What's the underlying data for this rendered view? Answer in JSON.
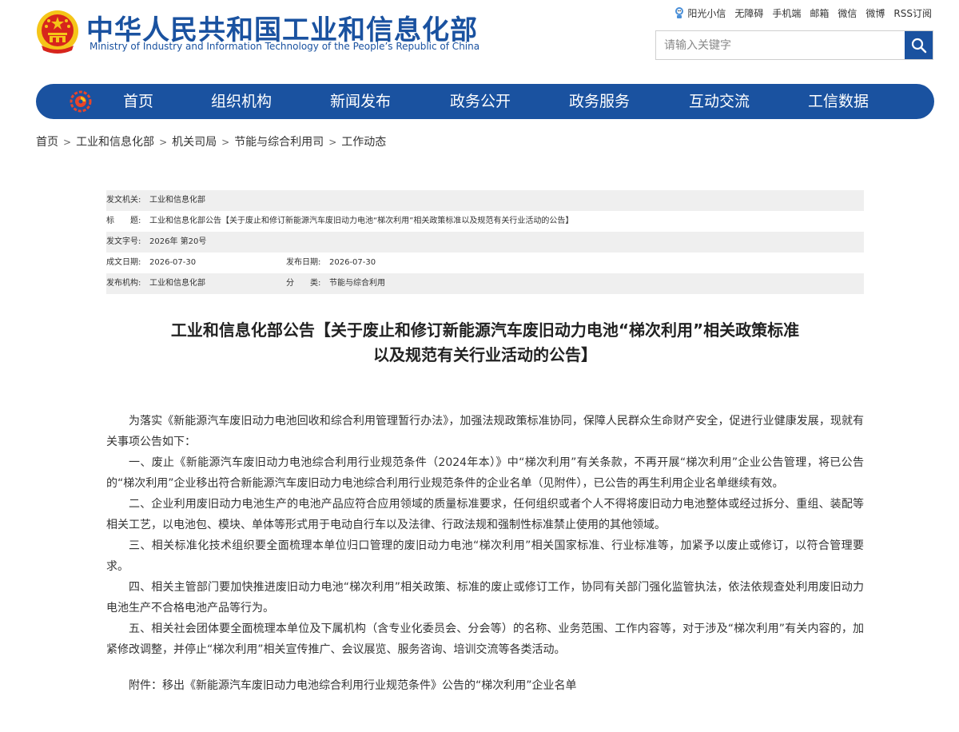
{
  "header": {
    "title_cn": "中华人民共和国工业和信息化部",
    "title_en": "Ministry of Industry and Information Technology of the People’s Republic of China",
    "top_links": [
      "阳光小信",
      "无障碍",
      "手机端",
      "邮箱",
      "微信",
      "微博",
      "RSS订阅"
    ]
  },
  "search": {
    "placeholder": "请输入关键字"
  },
  "nav": {
    "items": [
      "首页",
      "组织机构",
      "新闻发布",
      "政务公开",
      "政务服务",
      "互动交流",
      "工信数据"
    ]
  },
  "breadcrumb": [
    "首页",
    "工业和信息化部",
    "机关司局",
    "节能与综合利用司",
    "工作动态"
  ],
  "info": {
    "issuer_label": "发文机关:",
    "issuer": "工业和信息化部",
    "title_label": "标　　题:",
    "title": "工业和信息化部公告【关于废止和修订新能源汽车废旧动力电池“梯次利用”相关政策标准以及规范有关行业活动的公告】",
    "doc_no_label": "发文字号:",
    "doc_no": "2026年 第20号",
    "written_label": "成文日期:",
    "written_date": "2026-07-30",
    "published_label": "发布日期:",
    "published_date": "2026-07-30",
    "publisher_label": "发布机构:",
    "publisher": "工业和信息化部",
    "category_label": "分　　类:",
    "category": "节能与综合利用"
  },
  "article": {
    "title_line1": "工业和信息化部公告【关于废止和修订新能源汽车废旧动力电池“梯次利用”相关政策标准",
    "title_line2": "以及规范有关行业活动的公告】",
    "paragraphs": [
      "为落实《新能源汽车废旧动力电池回收和综合利用管理暂行办法》，加强法规政策标准协同，保障人民群众生命财产安全，促进行业健康发展，现就有关事项公告如下：",
      "一、废止《新能源汽车废旧动力电池综合利用行业规范条件（2024年本）》中“梯次利用”有关条款，不再开展“梯次利用”企业公告管理，将已公告的“梯次利用”企业移出符合新能源汽车废旧动力电池综合利用行业规范条件的企业名单（见附件），已公告的再生利用企业名单继续有效。",
      "二、企业利用废旧动力电池生产的电池产品应符合应用领域的质量标准要求，任何组织或者个人不得将废旧动力电池整体或经过拆分、重组、装配等相关工艺，以电池包、模块、单体等形式用于电动自行车以及法律、行政法规和强制性标准禁止使用的其他领域。",
      "三、相关标准化技术组织要全面梳理本单位归口管理的废旧动力电池“梯次利用”相关国家标准、行业标准等，加紧予以废止或修订，以符合管理要求。",
      "四、相关主管部门要加快推进废旧动力电池“梯次利用”相关政策、标准的废止或修订工作，协同有关部门强化监管执法，依法依规查处利用废旧动力电池生产不合格电池产品等行为。",
      "五、相关社会团体要全面梳理本单位及下属机构（含专业化委员会、分会等）的名称、业务范围、工作内容等，对于涉及“梯次利用”有关内容的，加紧修改调整，并停止“梯次利用”相关宣传推广、会议展览、服务咨询、培训交流等各类活动。"
    ],
    "attachment": "附件：移出《新能源汽车废旧动力电池综合利用行业规范条件》公告的“梯次利用”企业名单"
  },
  "colors": {
    "brand_blue": "#1a52a0",
    "emblem_red": "#d7251c",
    "emblem_gold": "#f5c518",
    "table_shade": "#efefef"
  },
  "icons": [
    "national-emblem-icon",
    "sun-mascot-icon",
    "search-icon",
    "miit-logo-icon"
  ]
}
